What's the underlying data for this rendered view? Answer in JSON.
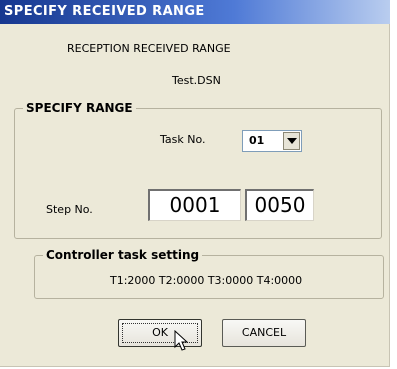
{
  "window": {
    "title": "SPECIFY RECEIVED RANGE"
  },
  "header": {
    "line1": "RECEPTION RECEIVED RANGE",
    "filename": "Test.DSN"
  },
  "specify_range": {
    "legend": "SPECIFY RANGE",
    "task_label": "Task No.",
    "task_value": "01",
    "step_label": "Step No.",
    "step_from": "0001",
    "step_separator": "-",
    "step_to": "0050"
  },
  "controller": {
    "legend": "Controller task setting",
    "values": "T1:2000 T2:0000 T3:0000 T4:0000"
  },
  "buttons": {
    "ok": "OK",
    "cancel": "CANCEL"
  },
  "icons": {
    "combo_arrow": "chevron-down-icon",
    "cursor": "mouse-pointer-icon"
  }
}
